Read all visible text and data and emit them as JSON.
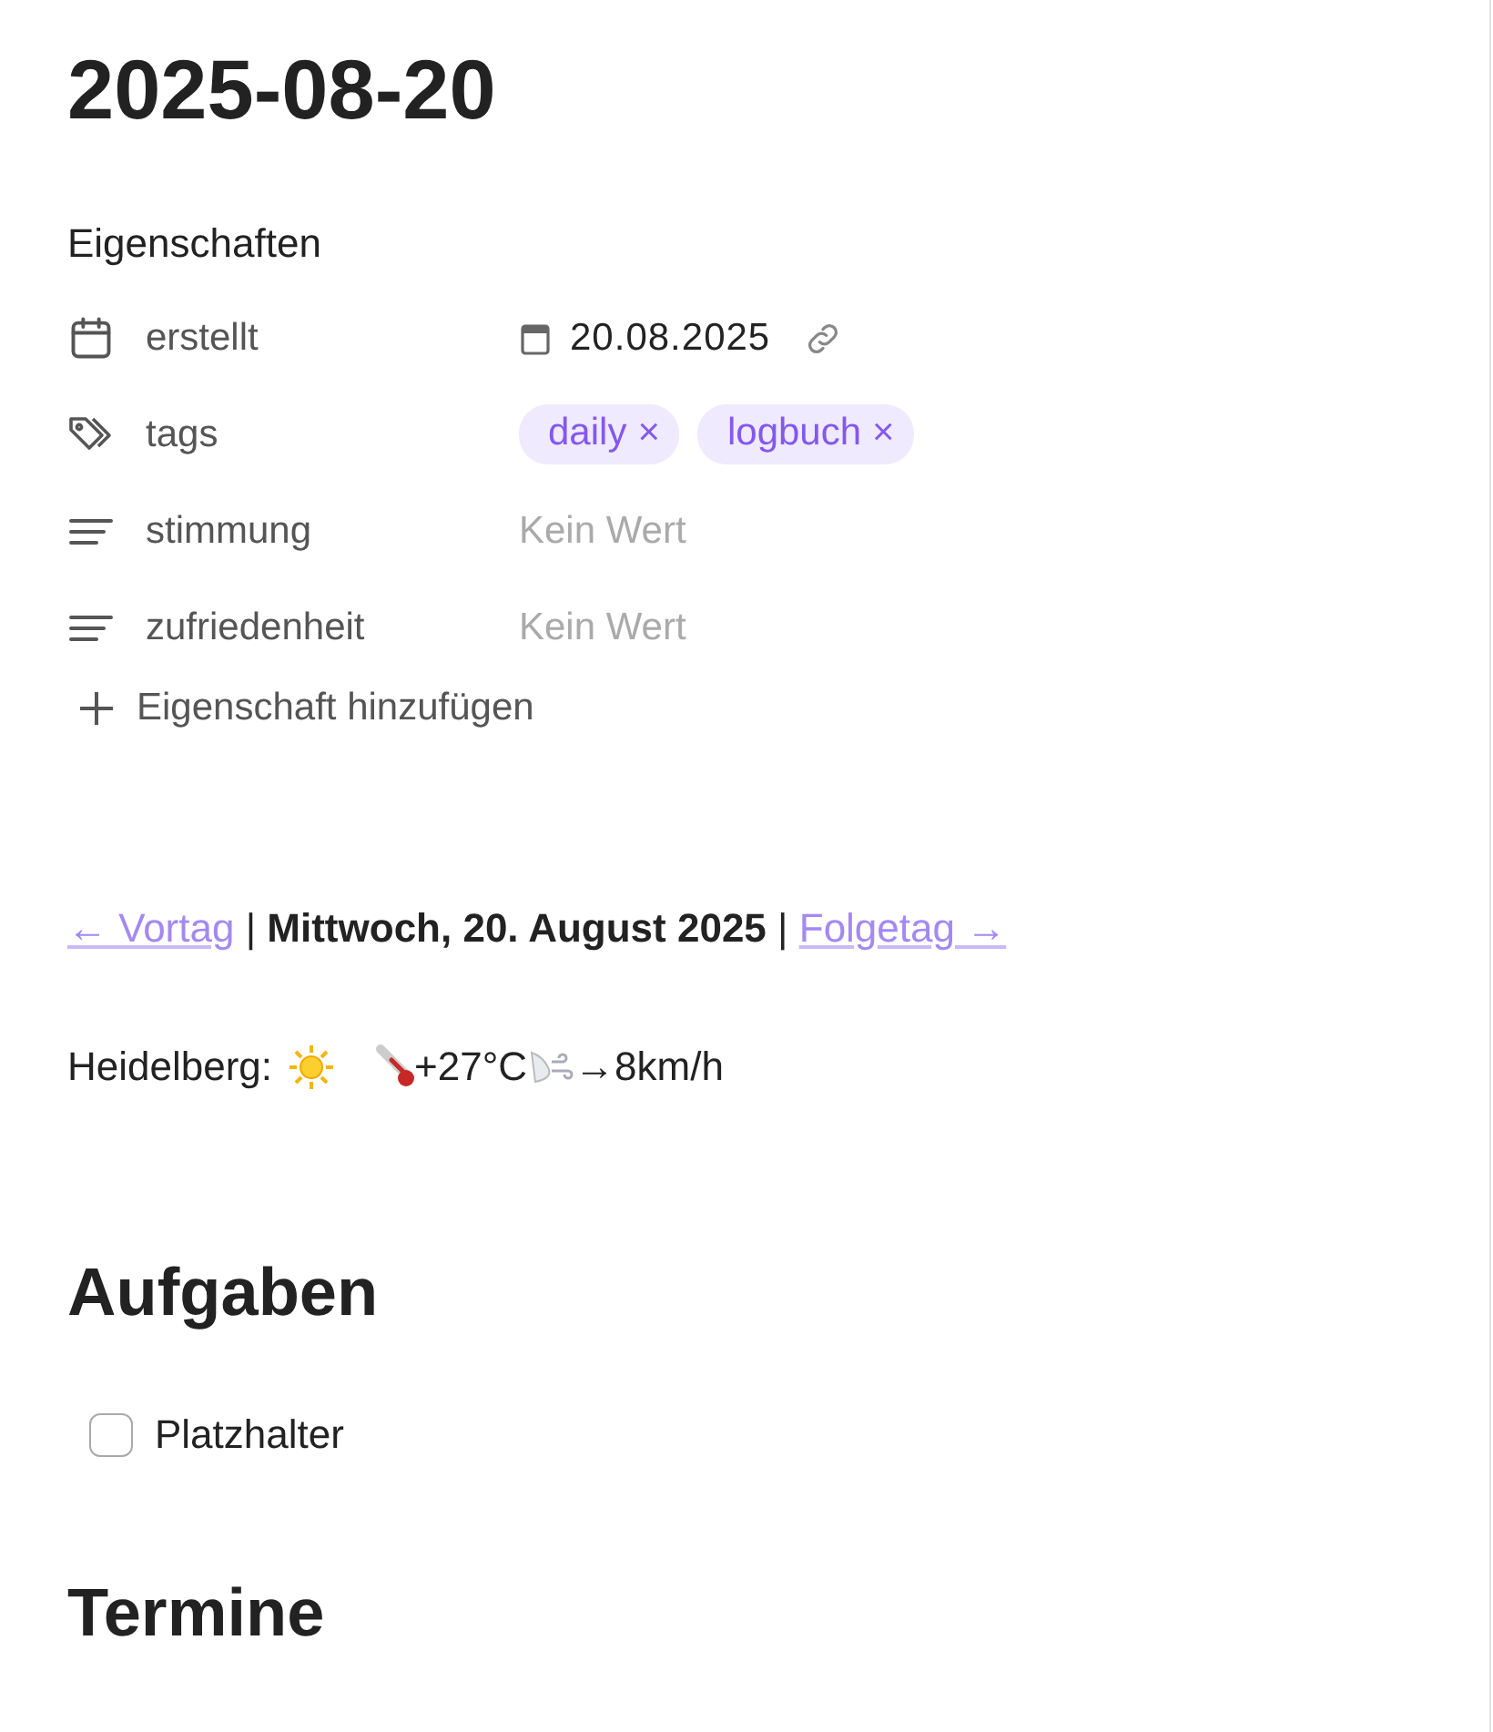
{
  "title": "2025-08-20",
  "properties": {
    "heading": "Eigenschaften",
    "add": "Eigenschaft hinzufügen",
    "items": [
      {
        "kind": "date",
        "label": "erstellt",
        "value": "20.08.2025"
      },
      {
        "kind": "tags",
        "label": "tags",
        "tags": [
          {
            "label": "daily",
            "remove": "×"
          },
          {
            "label": "logbuch",
            "remove": "×"
          }
        ]
      },
      {
        "kind": "text",
        "label": "stimmung",
        "placeholder": "Kein Wert"
      },
      {
        "kind": "text",
        "label": "zufriedenheit",
        "placeholder": "Kein Wert"
      }
    ]
  },
  "nav": {
    "previous": "← Vortag",
    "separator_1": "|",
    "current": "Mittwoch, 20. August 2025",
    "separator_2": "|",
    "next": "Folgetag →"
  },
  "weather": {
    "location": "Heidelberg:",
    "temperature": "+27°C",
    "wind": "→8km/h"
  },
  "tasks": {
    "heading": "Aufgaben",
    "items": [
      {
        "label": "Platzhalter",
        "checked": false
      }
    ]
  },
  "next_heading": "Termine"
}
